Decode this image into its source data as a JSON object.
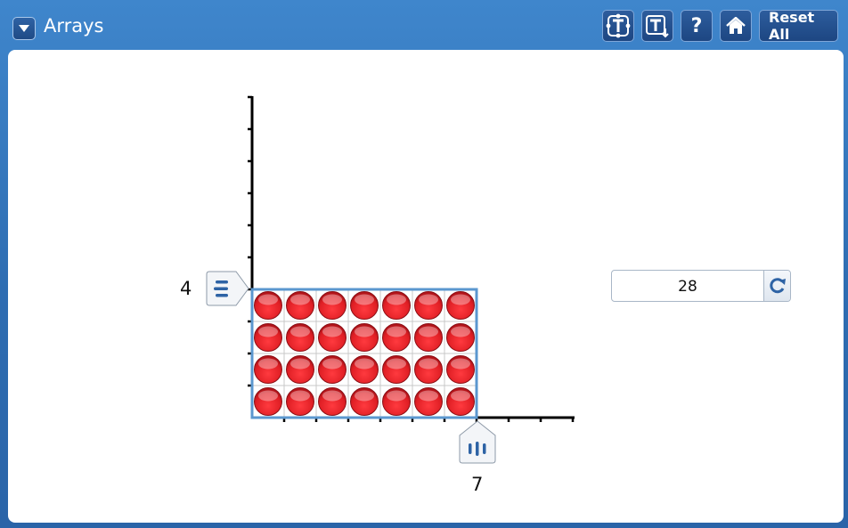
{
  "app": {
    "title": "Arrays"
  },
  "toolbar": {
    "reset_label": "Reset All",
    "buttons": [
      {
        "icon": "text-frame-icon"
      },
      {
        "icon": "text-down-icon"
      },
      {
        "icon": "help-icon",
        "glyph": "?"
      },
      {
        "icon": "home-icon"
      }
    ]
  },
  "array": {
    "rows": 4,
    "columns": 7,
    "row_label": "4",
    "column_label": "7",
    "counter_color": "#e01f25",
    "border_color": "#5b97cf"
  },
  "answer": {
    "value": "28"
  }
}
